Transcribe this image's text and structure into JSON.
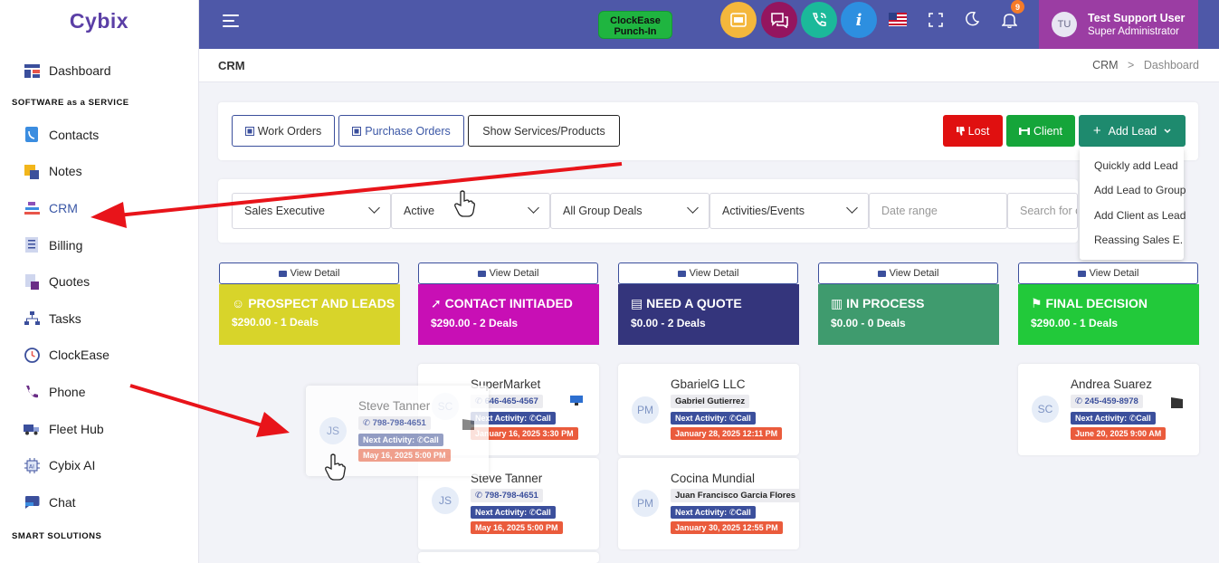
{
  "app": {
    "logo": "Cybix"
  },
  "sidebar": {
    "items": [
      {
        "label": "Dashboard",
        "icon": "dashboard-icon"
      },
      {
        "section": "SOFTWARE as a SERVICE"
      },
      {
        "label": "Contacts",
        "icon": "contacts-icon"
      },
      {
        "label": "Notes",
        "icon": "notes-icon"
      },
      {
        "label": "CRM",
        "icon": "crm-icon",
        "active": true
      },
      {
        "label": "Billing",
        "icon": "billing-icon"
      },
      {
        "label": "Quotes",
        "icon": "quotes-icon"
      },
      {
        "label": "Tasks",
        "icon": "tasks-icon"
      },
      {
        "label": "ClockEase",
        "icon": "clock-icon"
      },
      {
        "label": "Phone",
        "icon": "phone-icon"
      },
      {
        "label": "Fleet Hub",
        "icon": "truck-icon"
      },
      {
        "label": "Cybix AI",
        "icon": "ai-chip-icon"
      },
      {
        "label": "Chat",
        "icon": "chat-icon"
      },
      {
        "section": "SMART SOLUTIONS"
      }
    ]
  },
  "topbar": {
    "punch_line1": "ClockEase",
    "punch_line2": "Punch-In",
    "notification_count": "9",
    "user_initials": "TU",
    "user_name": "Test Support User",
    "user_role": "Super Administrator",
    "info_glyph": "i"
  },
  "breadcrumb": {
    "title": "CRM",
    "trail_1": "CRM",
    "separator": ">",
    "trail_2": "Dashboard"
  },
  "actions": {
    "work_orders": "Work Orders",
    "purchase_orders": "Purchase Orders",
    "show_services": "Show Services/Products",
    "lost": "Lost",
    "client": "Client",
    "add_lead": "Add Lead"
  },
  "add_lead_menu": [
    "Quickly add Lead",
    "Add Lead to Group",
    "Add Client as Lead",
    "Reassing Sales E."
  ],
  "filters": {
    "sales_exec": "Sales Executive",
    "status": "Active",
    "group": "All Group Deals",
    "activities": "Activities/Events",
    "date_placeholder": "Date range",
    "search_placeholder": "Search for c"
  },
  "view_detail": "View Detail",
  "stages": [
    {
      "title": "PROSPECT AND LEADS",
      "sub": "$290.00 - 1 Deals",
      "color": "#d8d42a",
      "icon": "smile-icon"
    },
    {
      "title": "CONTACT INITIADED",
      "sub": "$290.00 - 2 Deals",
      "color": "#c80fb5",
      "icon": "rocket-icon"
    },
    {
      "title": "NEED A QUOTE",
      "sub": "$0.00 - 2 Deals",
      "color": "#34357c",
      "icon": "document-icon"
    },
    {
      "title": "IN PROCESS",
      "sub": "$0.00 - 0 Deals",
      "color": "#3f9b6e",
      "icon": "clipboard-icon"
    },
    {
      "title": "FINAL DECISION",
      "sub": "$290.00 - 1 Deals",
      "color": "#22c93a",
      "icon": "flag-hand-icon"
    }
  ],
  "leads": {
    "drag": {
      "initials": "JS",
      "name": "Steve Tanner",
      "phone": "798-798-4651",
      "next": "Next Activity:",
      "act": "Call",
      "date": "May 16, 2025 5:00 PM"
    },
    "c2a": {
      "initials": "SC",
      "name": "SuperMarket",
      "phone": "646-465-4567",
      "next": "Next Activity:",
      "act": "Call",
      "date": "January 16, 2025 3:30 PM"
    },
    "c2b": {
      "initials": "JS",
      "name": "Steve Tanner",
      "phone": "798-798-4651",
      "next": "Next Activity:",
      "act": "Call",
      "date": "May 16, 2025 5:00 PM"
    },
    "c3a": {
      "initials": "PM",
      "name": "GbarielG LLC",
      "contact": "Gabriel Gutierrez",
      "next": "Next Activity:",
      "act": "Call",
      "date": "January 28, 2025 12:11 PM"
    },
    "c3b": {
      "initials": "PM",
      "name": "Cocina Mundial",
      "contact": "Juan Francisco Garcia Flores",
      "next": "Next Activity:",
      "act": "Call",
      "date": "January 30, 2025 12:55 PM"
    },
    "c5a": {
      "initials": "SC",
      "name": "Andrea Suarez",
      "phone": "245-459-8978",
      "next": "Next Activity:",
      "act": "Call",
      "date": "June 20, 2025 9:00 AM"
    }
  },
  "colors": {
    "topbar": "#4e58a8",
    "accent": "#3b4f9c",
    "lost": "#e01010",
    "client": "#15a53a",
    "add_lead": "#1e8a6e",
    "annotation_arrow": "#e8141a"
  }
}
